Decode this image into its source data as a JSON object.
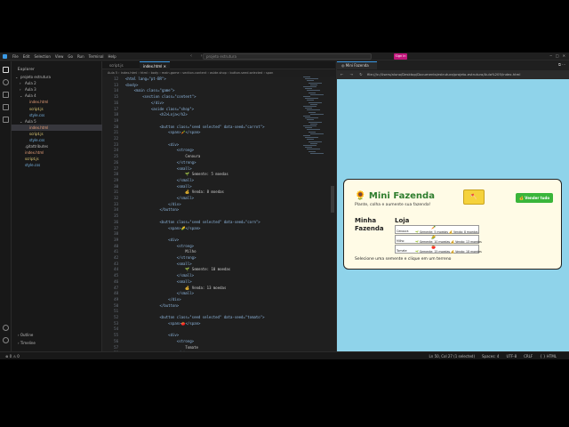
{
  "titlebar": {
    "menu": [
      "File",
      "Edit",
      "Selection",
      "View",
      "Go",
      "Run",
      "Terminal",
      "Help"
    ],
    "search": "projeto estrutura",
    "signin": "Sign in"
  },
  "explorer": {
    "title": "Explorer",
    "items": [
      {
        "label": "projeto estrutura",
        "indent": 0,
        "arrow": "⌄"
      },
      {
        "label": "Aula 2",
        "indent": 1,
        "arrow": "›"
      },
      {
        "label": "Aula 3",
        "indent": 1,
        "arrow": "›"
      },
      {
        "label": "Aula 4",
        "indent": 1,
        "arrow": "⌄"
      },
      {
        "label": "index.html",
        "indent": 2,
        "arrow": ""
      },
      {
        "label": "script.js",
        "indent": 2,
        "arrow": ""
      },
      {
        "label": "style.css",
        "indent": 2,
        "arrow": ""
      },
      {
        "label": "Aula 5",
        "indent": 1,
        "arrow": "⌄"
      },
      {
        "label": "index.html",
        "indent": 2,
        "arrow": "",
        "selected": true
      },
      {
        "label": "script.js",
        "indent": 2,
        "arrow": ""
      },
      {
        "label": "style.css",
        "indent": 2,
        "arrow": ""
      },
      {
        "label": ".gitattributes",
        "indent": 1,
        "arrow": ""
      },
      {
        "label": "index.html",
        "indent": 1,
        "arrow": ""
      },
      {
        "label": "script.js",
        "indent": 1,
        "arrow": ""
      },
      {
        "label": "style.css",
        "indent": 1,
        "arrow": ""
      }
    ],
    "outline": "Outline",
    "timeline": "Timeline"
  },
  "tabs": [
    {
      "label": "script.js",
      "active": false
    },
    {
      "label": "index.html",
      "active": true
    }
  ],
  "breadcrumb": "Aula 5 › index.html › html › body › main.game › section.content › aside.shop › button.seed.selected › span",
  "code": {
    "start": 12,
    "lines": [
      "<html lang=\"pt-BR\">",
      "<body>",
      "    <main class=\"game\">",
      "        <section class=\"content\">",
      "            </div>",
      "            <aside class=\"shop\">",
      "                <h2>Loja</h2>",
      "",
      "                <button class=\"seed selected\" data-seed=\"carrot\">",
      "                    <span>🥕</span>",
      "",
      "                    <div>",
      "                        <strong>",
      "                            Cenoura",
      "                        </strong>",
      "                        <small>",
      "                            🌱 Semente: 5 moedas",
      "                        </small>",
      "                        <small>",
      "                            💰 Venda: 8 moedas",
      "                        </small>",
      "                    </div>",
      "                </button>",
      "",
      "                <button class=\"seed selected\" data-seed=\"corn\">",
      "                    <span>🌽</span>",
      "",
      "                    <div>",
      "                        <strong>",
      "                            Milho",
      "                        </strong>",
      "                        <small>",
      "                            🌱 Semente: 10 moedas",
      "                        </small>",
      "                        <small>",
      "                            💰 Venda: 13 moedas",
      "                        </small>",
      "                    </div>",
      "                </button>",
      "",
      "                <button class=\"seed selected\" data-seed=\"tomato\">",
      "                    <span>🍅</span>",
      "",
      "                    <div>",
      "                        <strong>",
      "                            Tomate",
      "                        </strong>"
    ]
  },
  "browser": {
    "tab": "Mini Fazenda",
    "url": "file:///c:/Users/aluno/Desktop/Documents/estrutura/projeto-estrutura/Aula%205/index.html"
  },
  "game": {
    "title": "🌻 Mini Fazenda",
    "subtitle": "Plante, colha e aumente sua fazenda!",
    "shovel": "🪓",
    "sell_button": "💰 Vender tudo",
    "farm_title_1": "Minha",
    "farm_title_2": "Fazenda",
    "shop_title": "Loja",
    "seeds": [
      {
        "icon": "🥕",
        "name": "Cenoura",
        "details": "🌱 Semente: 5 moedas  💰 Venda: 8 moedas"
      },
      {
        "icon": "🌽",
        "name": "Milho",
        "details": "🌱 Semente: 10 moedas  💰 Venda: 13 moedas"
      },
      {
        "icon": "🍅",
        "name": "Tomate",
        "details": "🌱 Semente: 15 moedas  💰 Venda: 18 moedas"
      }
    ],
    "message": "Selecione uma semente e clique em um terreno"
  },
  "status": {
    "left": "⊗ 0 ⚠ 0",
    "items": [
      "Ln 50, Col 27 (1 selected)",
      "Spaces: 4",
      "UTF-8",
      "CRLF",
      "{ } HTML"
    ]
  }
}
